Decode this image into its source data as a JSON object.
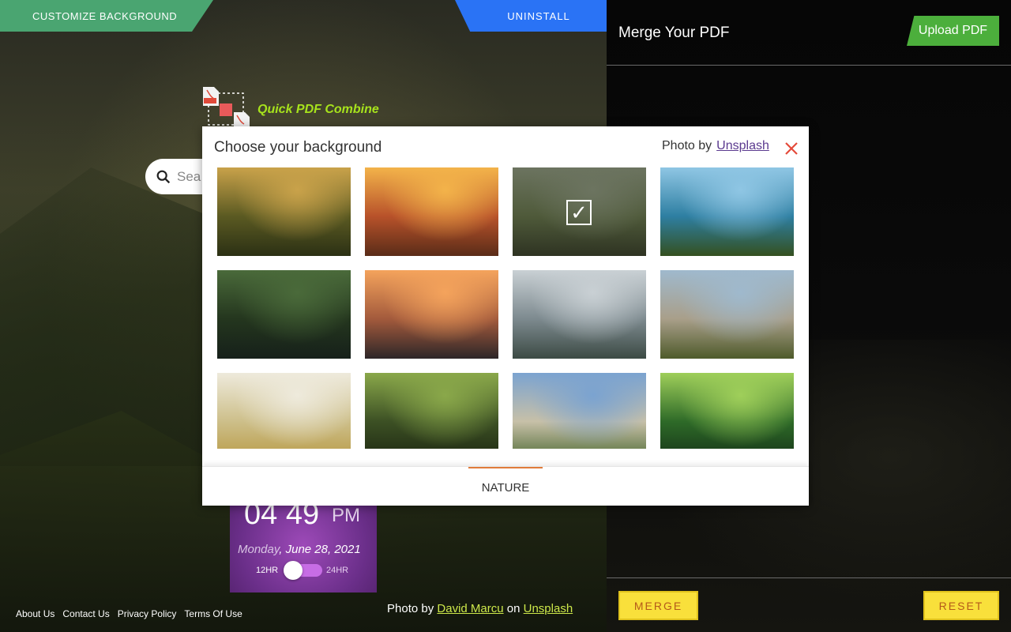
{
  "top_bar": {
    "customize_label": "CUSTOMIZE BACKGROUND",
    "uninstall_label": "UNINSTALL"
  },
  "logo": {
    "text": "Quick PDF Combine"
  },
  "search": {
    "placeholder": "Sea"
  },
  "right_panel": {
    "title": "Merge Your PDF",
    "upload_label": "Upload PDF",
    "merge_label": "MERGE",
    "reset_label": "RESET"
  },
  "clock": {
    "time": "04 49",
    "ampm": "PM",
    "day": "Monday",
    "separator": ",",
    "date": " June 28, 2021",
    "format_12": "12HR",
    "format_24": "24HR"
  },
  "footer": {
    "links": [
      "About Us",
      "Contact Us",
      "Privacy Policy",
      "Terms Of Use"
    ],
    "photo_by": "Photo by",
    "photographer": "David Marcu",
    "on": "on",
    "source": "Unsplash"
  },
  "modal": {
    "title": "Choose your background",
    "photo_by": "Photo by",
    "source": "Unsplash",
    "selected_index": 2,
    "tabs": [
      "NATURE"
    ],
    "thumbnails": [
      {
        "name": "tree-valley",
        "colors": [
          "#c9a24a",
          "#5b5a22",
          "#2b3014"
        ]
      },
      {
        "name": "autumn-forest",
        "colors": [
          "#f3b34a",
          "#b8522a",
          "#5a2c18"
        ]
      },
      {
        "name": "cliff-view",
        "colors": [
          "#6c7460",
          "#4f5a3a",
          "#2e3322"
        ]
      },
      {
        "name": "lake-island",
        "colors": [
          "#8fc6e4",
          "#2e7fa2",
          "#34501f"
        ]
      },
      {
        "name": "forest-bridge",
        "colors": [
          "#4a6a3a",
          "#24361e",
          "#16201a"
        ]
      },
      {
        "name": "mountain-sunset",
        "colors": [
          "#f4a35c",
          "#a35a3c",
          "#2d2628"
        ]
      },
      {
        "name": "alpine-lake",
        "colors": [
          "#c9d0d4",
          "#7d8a8f",
          "#3c4a44"
        ]
      },
      {
        "name": "granite-cliff",
        "colors": [
          "#9fb9cd",
          "#a99f8a",
          "#4e5a2a"
        ]
      },
      {
        "name": "lone-tree-field",
        "colors": [
          "#eeeadc",
          "#cdbf8a",
          "#b89a45"
        ]
      },
      {
        "name": "sunlit-woods",
        "colors": [
          "#8aa84a",
          "#3c5024",
          "#1e2812"
        ]
      },
      {
        "name": "misty-hills",
        "colors": [
          "#7ba3d0",
          "#c7c0a8",
          "#4e6a34"
        ]
      },
      {
        "name": "green-canopy",
        "colors": [
          "#9fcf5a",
          "#2e6a28",
          "#163418"
        ]
      }
    ]
  }
}
